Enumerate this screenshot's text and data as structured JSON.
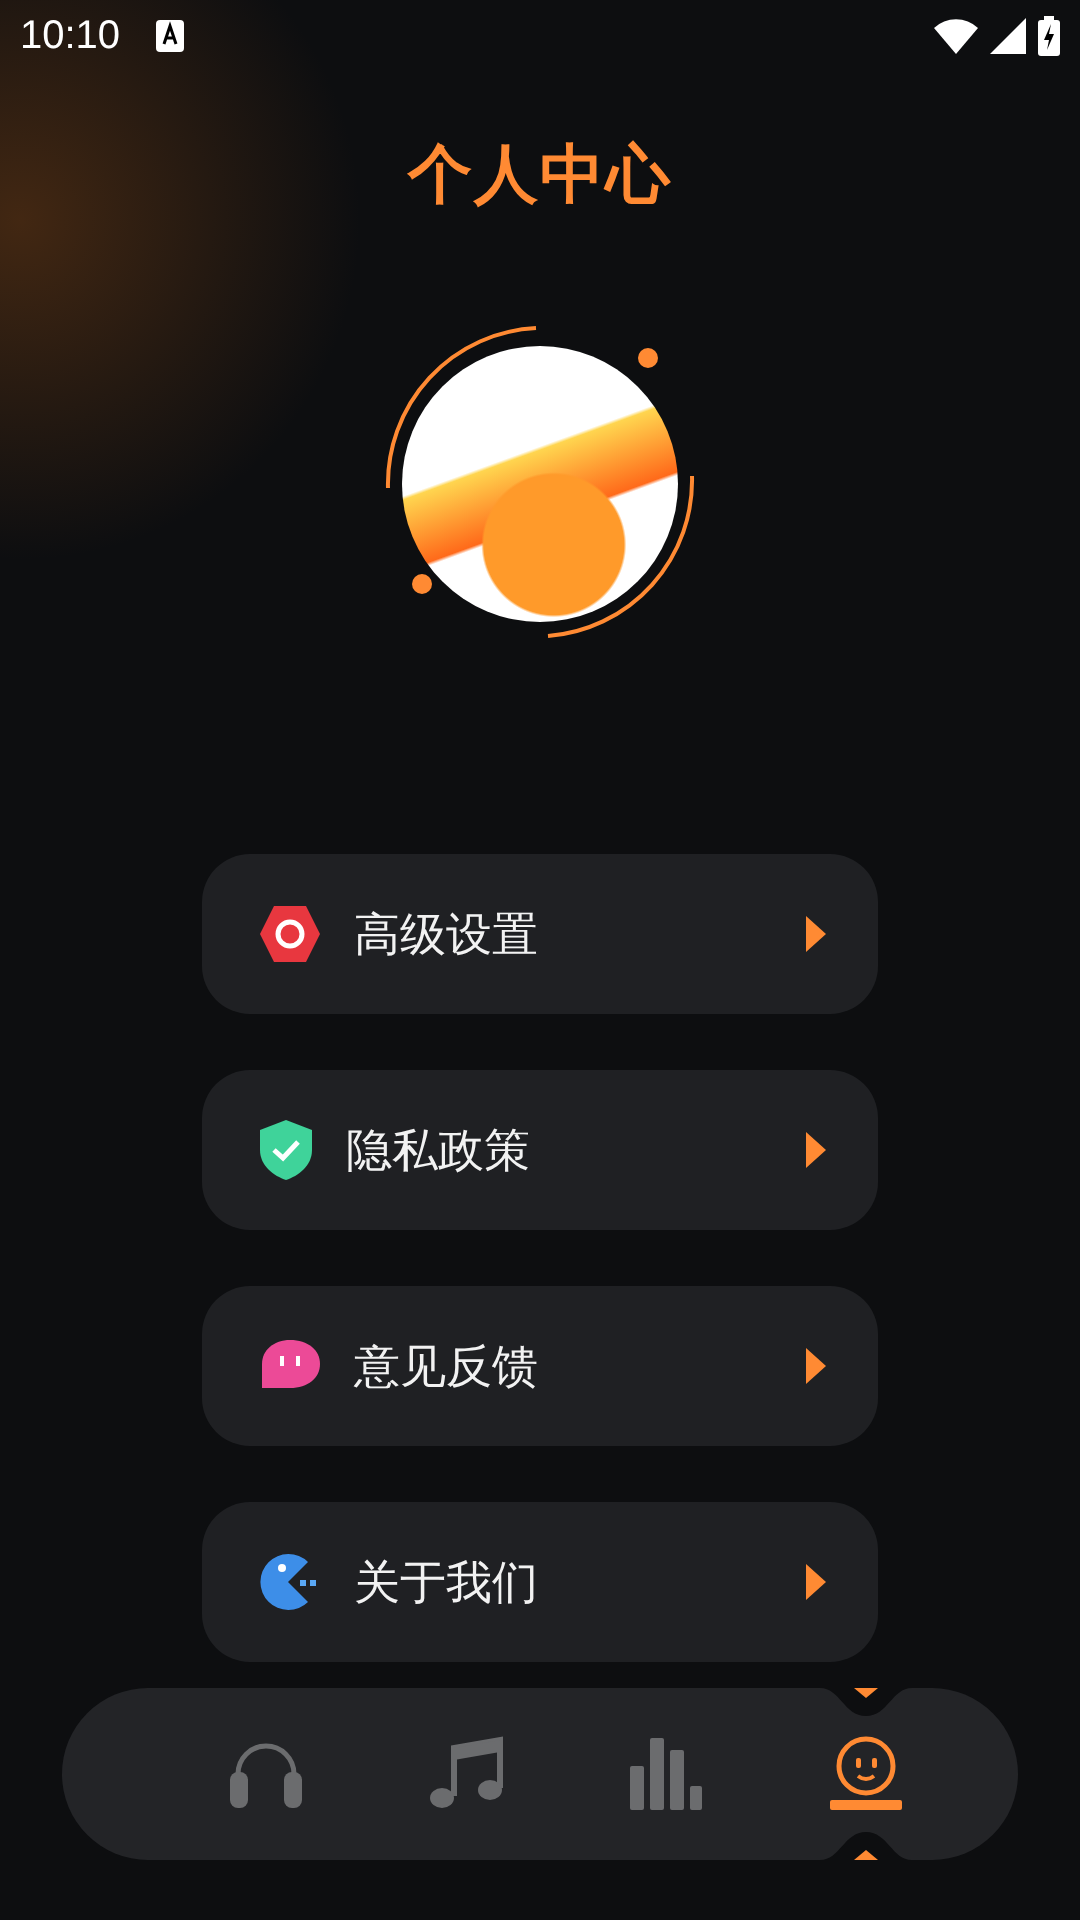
{
  "status_bar": {
    "time": "10:10"
  },
  "title": "个人中心",
  "menu": [
    {
      "kind": "settings",
      "label": "高级设置"
    },
    {
      "kind": "privacy",
      "label": "隐私政策"
    },
    {
      "kind": "feedback",
      "label": "意见反馈"
    },
    {
      "kind": "about",
      "label": "关于我们"
    }
  ],
  "nav": [
    {
      "kind": "headphones",
      "selected": false
    },
    {
      "kind": "music",
      "selected": false
    },
    {
      "kind": "chart",
      "selected": false
    },
    {
      "kind": "profile",
      "selected": true
    }
  ]
}
